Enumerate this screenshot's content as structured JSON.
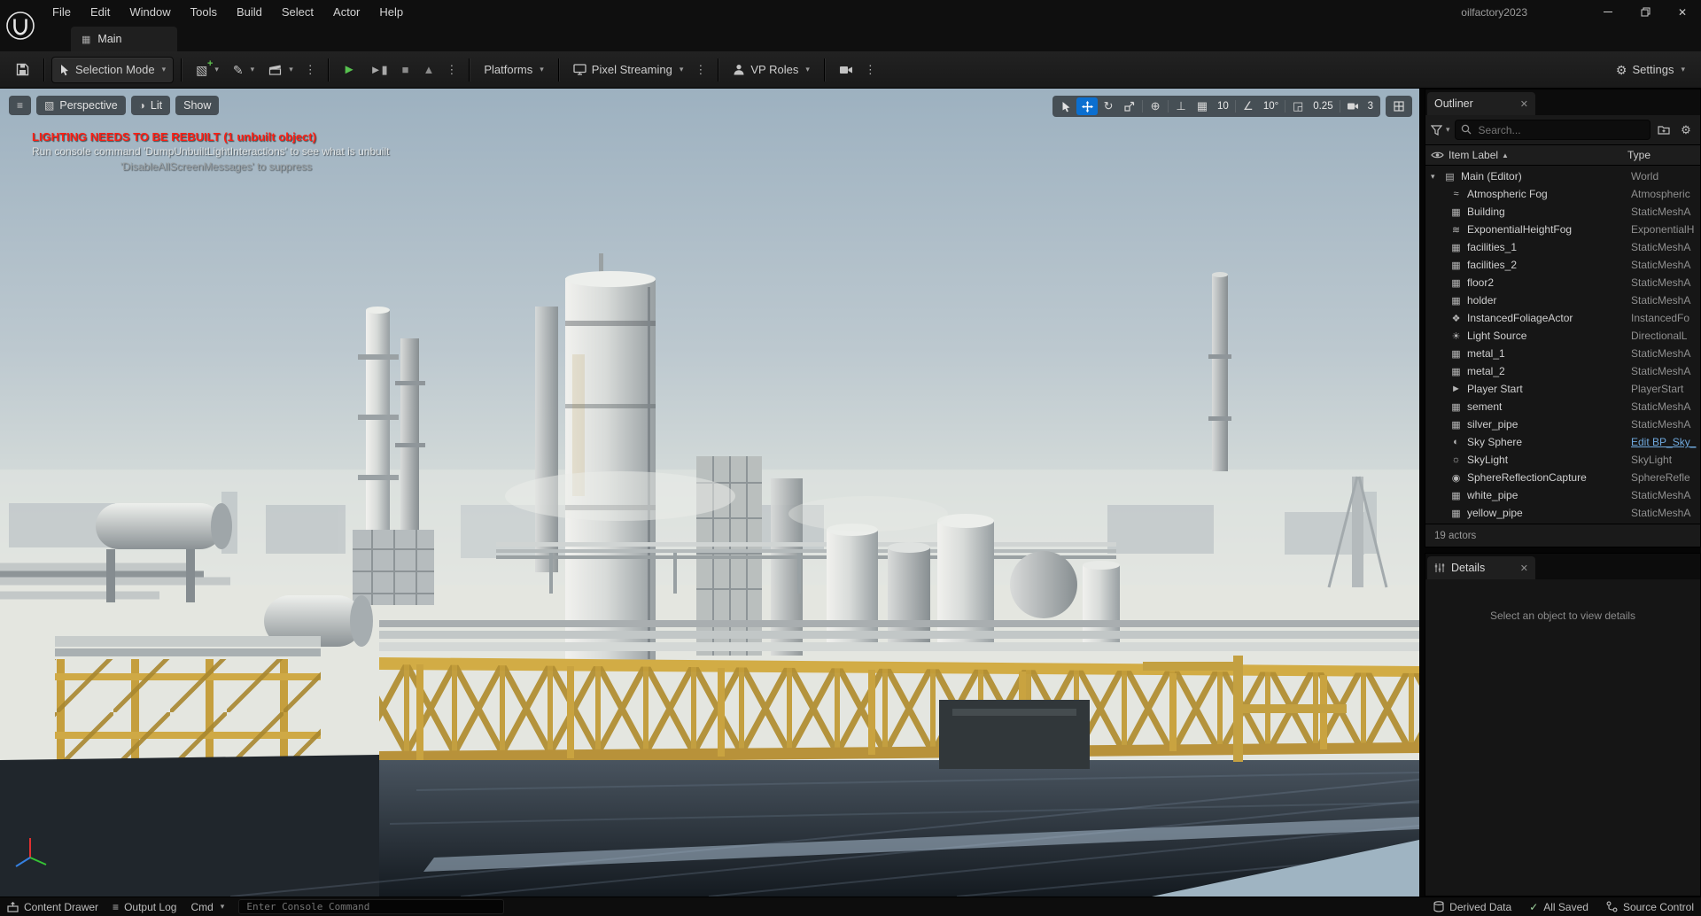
{
  "window": {
    "title": "oilfactory2023",
    "menus": [
      "File",
      "Edit",
      "Window",
      "Tools",
      "Build",
      "Select",
      "Actor",
      "Help"
    ],
    "tab": "Main"
  },
  "toolbar": {
    "mode_label": "Selection Mode",
    "platforms_label": "Platforms",
    "pixel_streaming_label": "Pixel Streaming",
    "vp_roles_label": "VP Roles",
    "settings_label": "Settings"
  },
  "viewport": {
    "perspective_label": "Perspective",
    "lit_label": "Lit",
    "show_label": "Show",
    "warning": {
      "line1": "LIGHTING NEEDS TO BE REBUILT (1 unbuilt object)",
      "line2": "Run console command 'DumpUnbuiltLightInteractions' to see what is unbuilt",
      "line3": "'DisableAllScreenMessages' to suppress"
    },
    "snaps": {
      "grid": "10",
      "rotation": "10°",
      "scale": "0.25",
      "camera_speed": "3"
    }
  },
  "outliner": {
    "tab_title": "Outliner",
    "search_placeholder": "Search...",
    "columns": {
      "label": "Item Label",
      "type": "Type"
    },
    "footer": "19 actors",
    "icon_glyphs": {
      "world": "▤",
      "atmospheric-fog": "≈",
      "static-mesh": "▦",
      "height-fog": "≋",
      "foliage": "❖",
      "directional-light": "☀",
      "player-start": "►",
      "sky-sphere": "◐",
      "sky-light": "☼",
      "reflection-capture": "◉"
    },
    "rows": [
      {
        "label": "Main (Editor)",
        "type": "World",
        "icon": "world",
        "root": true
      },
      {
        "label": "Atmospheric Fog",
        "type": "Atmospheric",
        "icon": "atmospheric-fog"
      },
      {
        "label": "Building",
        "type": "StaticMeshA",
        "icon": "static-mesh"
      },
      {
        "label": "ExponentialHeightFog",
        "type": "ExponentialH",
        "icon": "height-fog"
      },
      {
        "label": "facilities_1",
        "type": "StaticMeshA",
        "icon": "static-mesh"
      },
      {
        "label": "facilities_2",
        "type": "StaticMeshA",
        "icon": "static-mesh"
      },
      {
        "label": "floor2",
        "type": "StaticMeshA",
        "icon": "static-mesh"
      },
      {
        "label": "holder",
        "type": "StaticMeshA",
        "icon": "static-mesh"
      },
      {
        "label": "InstancedFoliageActor",
        "type": "InstancedFo",
        "icon": "foliage"
      },
      {
        "label": "Light Source",
        "type": "DirectionalL",
        "icon": "directional-light"
      },
      {
        "label": "metal_1",
        "type": "StaticMeshA",
        "icon": "static-mesh"
      },
      {
        "label": "metal_2",
        "type": "StaticMeshA",
        "icon": "static-mesh"
      },
      {
        "label": "Player Start",
        "type": "PlayerStart",
        "icon": "player-start"
      },
      {
        "label": "sement",
        "type": "StaticMeshA",
        "icon": "static-mesh"
      },
      {
        "label": "silver_pipe",
        "type": "StaticMeshA",
        "icon": "static-mesh"
      },
      {
        "label": "Sky Sphere",
        "type": "Edit BP_Sky_",
        "icon": "sky-sphere",
        "link": true
      },
      {
        "label": "SkyLight",
        "type": "SkyLight",
        "icon": "sky-light"
      },
      {
        "label": "SphereReflectionCapture",
        "type": "SphereRefle",
        "icon": "reflection-capture"
      },
      {
        "label": "white_pipe",
        "type": "StaticMeshA",
        "icon": "static-mesh"
      },
      {
        "label": "yellow_pipe",
        "type": "StaticMeshA",
        "icon": "static-mesh"
      }
    ]
  },
  "details": {
    "tab_title": "Details",
    "empty_message": "Select an object to view details"
  },
  "statusbar": {
    "content_drawer": "Content Drawer",
    "output_log": "Output Log",
    "cmd_label": "Cmd",
    "console_placeholder": "Enter Console Command",
    "derived_data": "Derived Data",
    "all_saved": "All Saved",
    "source_control": "Source Control"
  },
  "colors": {
    "accent_blue": "#0070e0",
    "warning_red": "#ff1f14",
    "play_green": "#57c24f",
    "type_link_blue": "#6fa8dc"
  }
}
